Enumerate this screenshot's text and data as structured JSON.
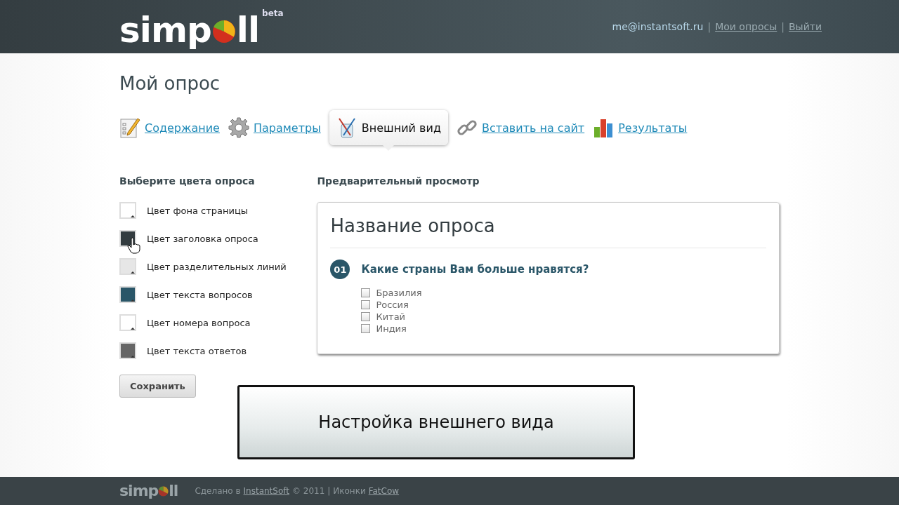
{
  "header": {
    "logo": {
      "text_before": "simp",
      "text_after": "ll",
      "badge": "beta"
    },
    "user_email": "me@instantsoft.ru",
    "links": [
      "Мои опросы",
      "Выйти"
    ],
    "separator": "|"
  },
  "page_title": "Мой опрос",
  "tabs": [
    {
      "label": "Содержание",
      "kind": "content",
      "selected": false
    },
    {
      "label": "Параметры",
      "kind": "settings",
      "selected": false
    },
    {
      "label": "Внешний вид",
      "kind": "appearance",
      "selected": true
    },
    {
      "label": "Вставить на сайт",
      "kind": "embed",
      "selected": false
    },
    {
      "label": "Результаты",
      "kind": "results",
      "selected": false
    }
  ],
  "colors_panel": {
    "heading": "Выберите цвета опроса",
    "items": [
      {
        "label": "Цвет фона страницы",
        "color": "#ffffff"
      },
      {
        "label": "Цвет заголовка опроса",
        "color": "#333c40"
      },
      {
        "label": "Цвет разделительных линий",
        "color": "#e6e6e6"
      },
      {
        "label": "Цвет текста вопросов",
        "color": "#2a5668"
      },
      {
        "label": "Цвет номера вопроса",
        "color": "#ffffff"
      },
      {
        "label": "Цвет текста ответов",
        "color": "#666666"
      }
    ],
    "save_button": "Сохранить"
  },
  "preview": {
    "heading": "Предварительный просмотр",
    "poll_title": "Название опроса",
    "question_number": "01",
    "question": "Какие страны Вам больше нравятся?",
    "answers": [
      {
        "label": "Бразилия",
        "checked": false
      },
      {
        "label": "Россия",
        "checked": false
      },
      {
        "label": "Китай",
        "checked": false
      },
      {
        "label": "Индия",
        "checked": false
      }
    ]
  },
  "caption": "Настройка внешнего вида",
  "footer": {
    "logo": {
      "text_before": "simp",
      "text_after": "ll"
    },
    "made_in": "Сделано в",
    "made_link": "InstantSoft",
    "year": "© 2011 |",
    "icons": "Иконки",
    "icons_link": "FatCow"
  }
}
